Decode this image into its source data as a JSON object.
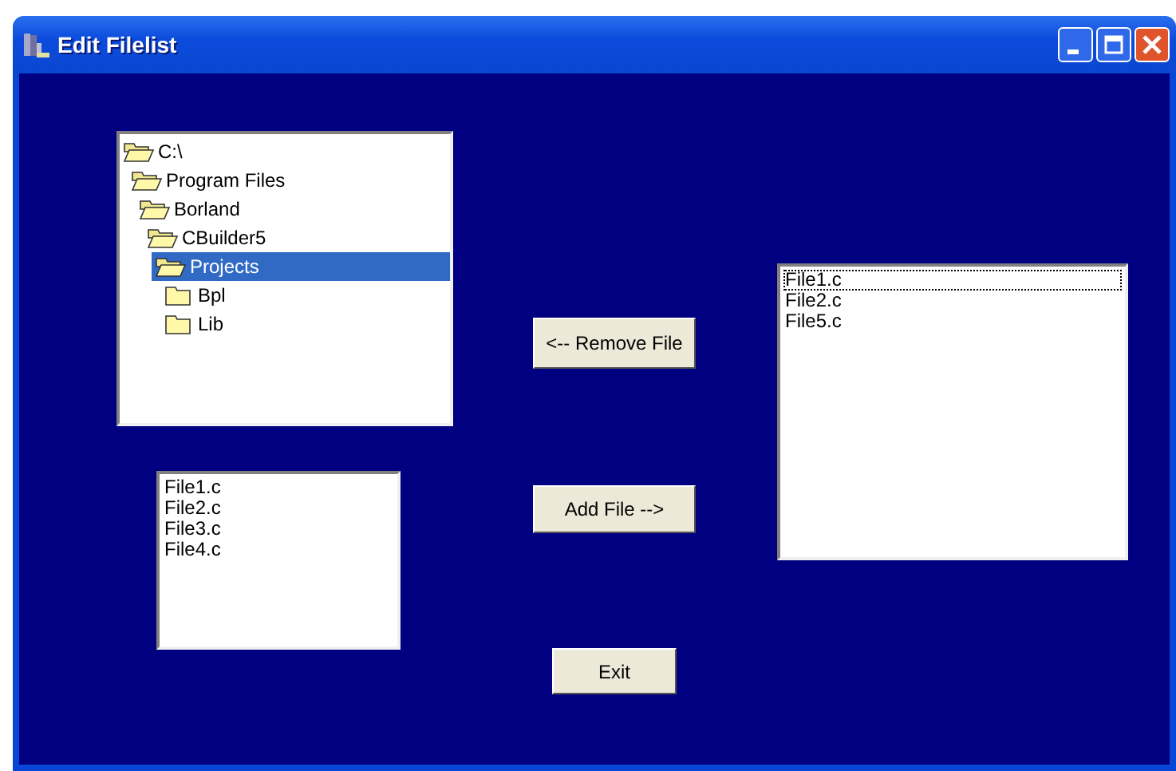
{
  "window": {
    "title": "Edit Filelist"
  },
  "tree": {
    "items": [
      {
        "label": "C:\\",
        "expanded": true,
        "selected": false,
        "children": [
          {
            "label": "Program Files",
            "expanded": true,
            "selected": false,
            "children": [
              {
                "label": "Borland",
                "expanded": true,
                "selected": false,
                "children": [
                  {
                    "label": "CBuilder5",
                    "expanded": true,
                    "selected": false,
                    "children": [
                      {
                        "label": "Projects",
                        "expanded": true,
                        "selected": true,
                        "children": [
                          {
                            "label": "Bpl",
                            "expanded": false,
                            "selected": false
                          },
                          {
                            "label": "Lib",
                            "expanded": false,
                            "selected": false
                          }
                        ]
                      }
                    ]
                  }
                ]
              }
            ]
          }
        ]
      }
    ]
  },
  "source_list": {
    "items": [
      {
        "label": "File1.c",
        "focused": false
      },
      {
        "label": "File2.c",
        "focused": false
      },
      {
        "label": "File3.c",
        "focused": false
      },
      {
        "label": "File4.c",
        "focused": false
      }
    ]
  },
  "buttons": {
    "remove": "<-- Remove File",
    "add": "Add File -->",
    "exit": "Exit"
  },
  "target_list": {
    "items": [
      {
        "label": "File1.c",
        "focused": true
      },
      {
        "label": "File2.c",
        "focused": false
      },
      {
        "label": "File5.c",
        "focused": false
      }
    ]
  }
}
